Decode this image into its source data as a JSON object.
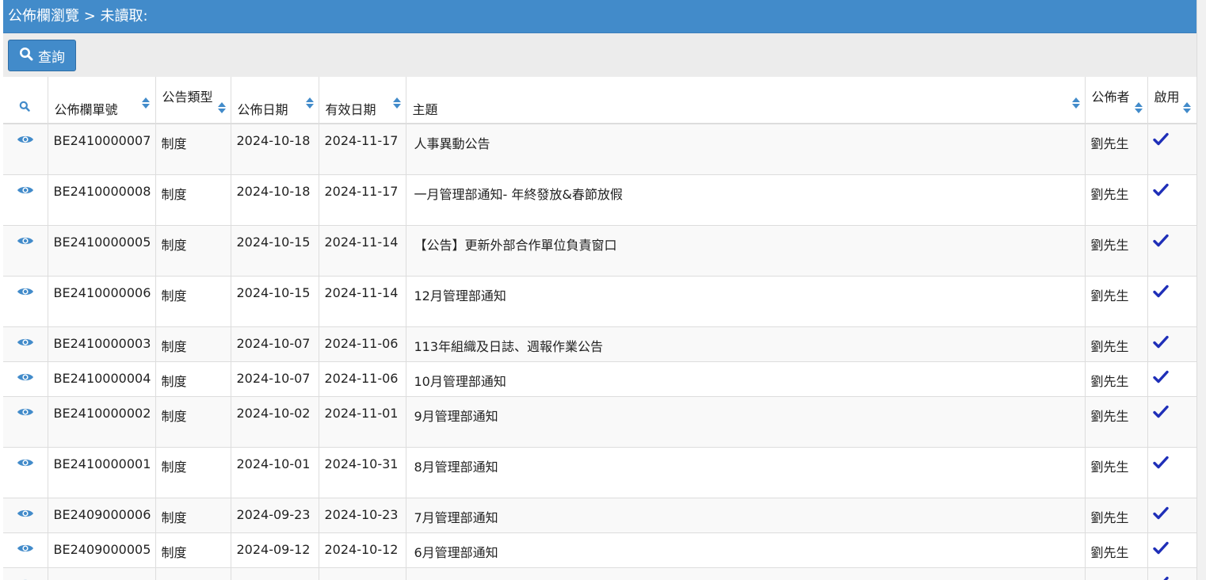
{
  "header": {
    "title": "公佈欄瀏覽 > 未讀取:"
  },
  "toolbar": {
    "query_label": "查詢"
  },
  "table": {
    "columns": [
      "公佈欄單號",
      "公告類型",
      "公佈日期",
      "有效日期",
      "主題",
      "公佈者",
      "啟用"
    ],
    "rows": [
      {
        "id": "BE2410000007",
        "type": "制度",
        "publish": "2024-10-18",
        "valid": "2024-11-17",
        "subject": "人事異動公告",
        "publisher": "劉先生"
      },
      {
        "id": "BE2410000008",
        "type": "制度",
        "publish": "2024-10-18",
        "valid": "2024-11-17",
        "subject": "一月管理部通知- 年終發放&春節放假",
        "publisher": "劉先生"
      },
      {
        "id": "BE2410000005",
        "type": "制度",
        "publish": "2024-10-15",
        "valid": "2024-11-14",
        "subject": "【公告】更新外部合作單位負責窗口",
        "publisher": "劉先生"
      },
      {
        "id": "BE2410000006",
        "type": "制度",
        "publish": "2024-10-15",
        "valid": "2024-11-14",
        "subject": "12月管理部通知",
        "publisher": "劉先生"
      },
      {
        "id": "BE2410000003",
        "type": "制度",
        "publish": "2024-10-07",
        "valid": "2024-11-06",
        "subject": "113年組織及日誌、週報作業公告",
        "publisher": "劉先生"
      },
      {
        "id": "BE2410000004",
        "type": "制度",
        "publish": "2024-10-07",
        "valid": "2024-11-06",
        "subject": "10月管理部通知",
        "publisher": "劉先生"
      },
      {
        "id": "BE2410000002",
        "type": "制度",
        "publish": "2024-10-02",
        "valid": "2024-11-01",
        "subject": "9月管理部通知",
        "publisher": "劉先生"
      },
      {
        "id": "BE2410000001",
        "type": "制度",
        "publish": "2024-10-01",
        "valid": "2024-10-31",
        "subject": "8月管理部通知",
        "publisher": "劉先生"
      },
      {
        "id": "BE2409000006",
        "type": "制度",
        "publish": "2024-09-23",
        "valid": "2024-10-23",
        "subject": "7月管理部通知",
        "publisher": "劉先生"
      },
      {
        "id": "BE2409000005",
        "type": "制度",
        "publish": "2024-09-12",
        "valid": "2024-10-12",
        "subject": "6月管理部通知",
        "publisher": "劉先生"
      }
    ]
  },
  "colors": {
    "primary": "#428bca",
    "check": "#1f2fb8"
  }
}
